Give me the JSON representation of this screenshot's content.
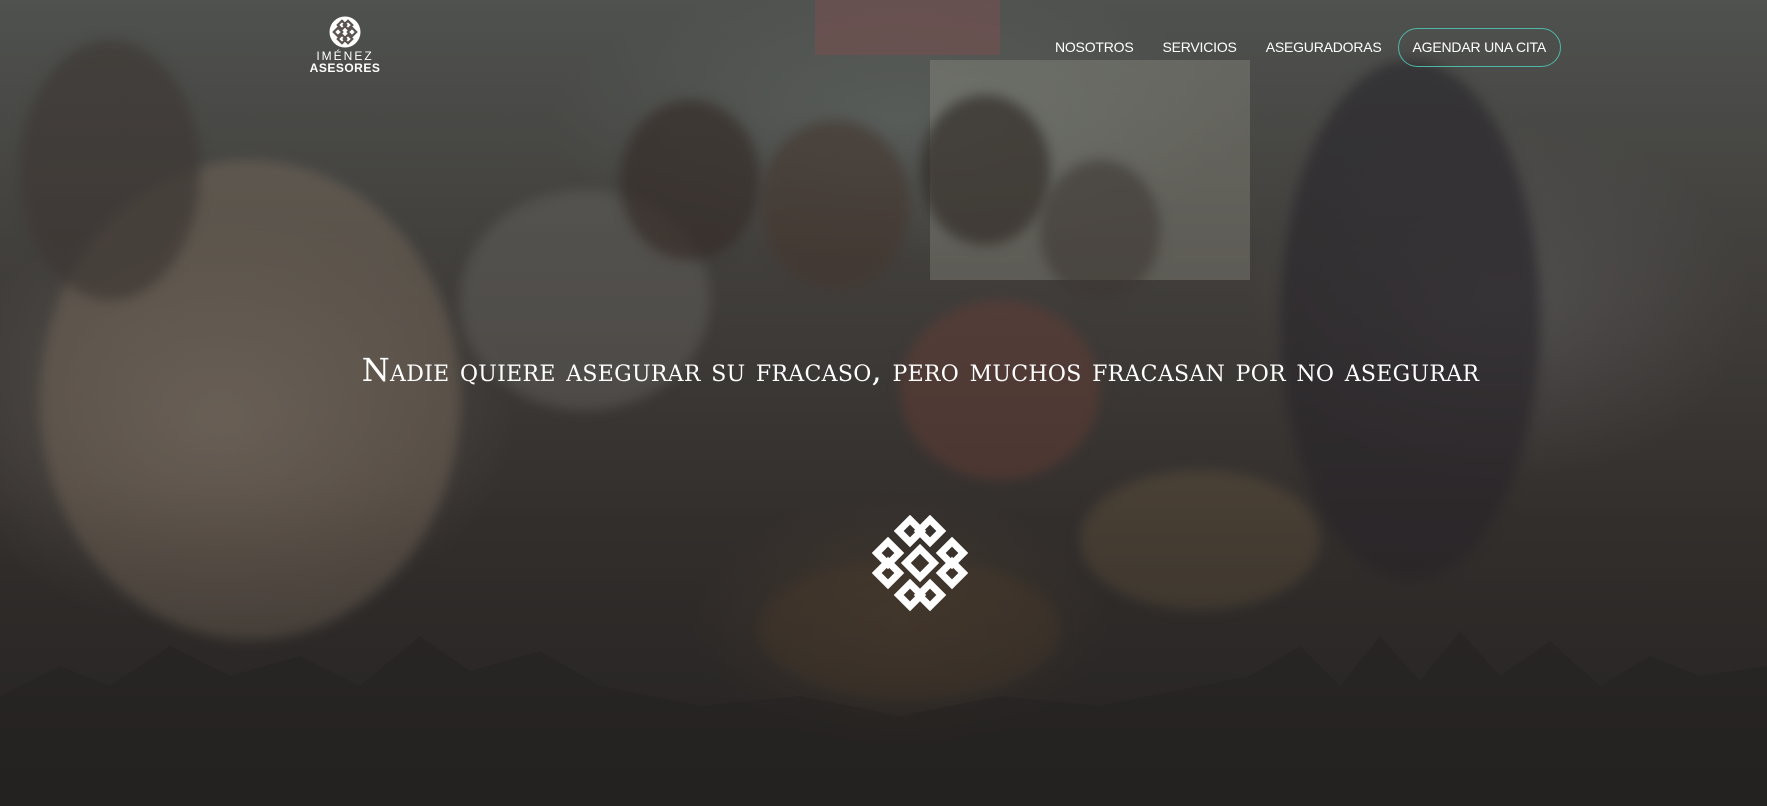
{
  "brand": {
    "logo_line1": "IMÉNEZ",
    "logo_line2": "ASESORES"
  },
  "nav": {
    "items": [
      "NOSOTROS",
      "SERVICIOS",
      "ASEGURADORAS"
    ],
    "cta": "AGENDAR UNA CITA"
  },
  "hero": {
    "headline": "Nadie quiere asegurar su fracaso, pero muchos fracasan por no asegurar"
  },
  "colors": {
    "accent": "#4fb7a7",
    "text": "#ffffff"
  },
  "icons": {
    "logo": "knot-emblem-icon",
    "emblem": "knot-emblem-icon"
  }
}
